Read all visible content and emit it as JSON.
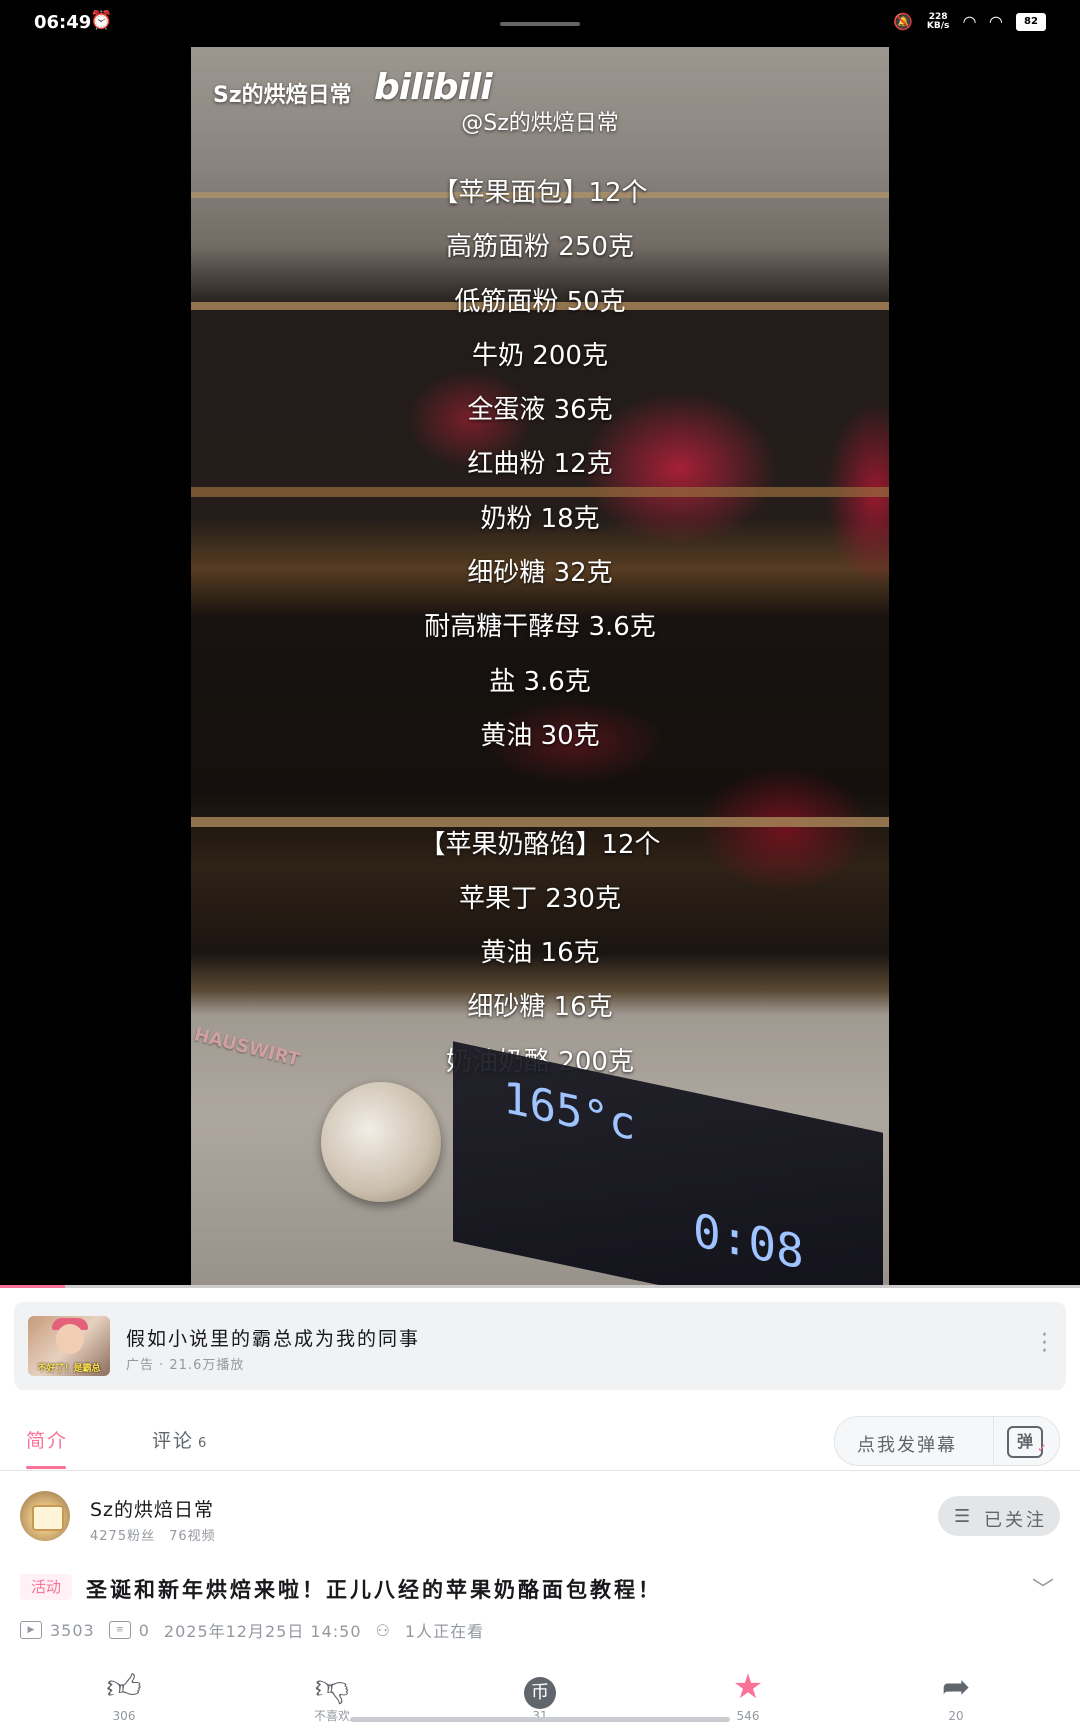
{
  "status_bar": {
    "time": "06:49",
    "alarm_icon": "alarm-icon",
    "net_speed": "228\nKB/s",
    "battery": "82"
  },
  "video": {
    "brand_text": "Sz的烘焙日常",
    "brand_logo": "bilibili",
    "watermark": "@Sz的烘焙日常",
    "recipe_lines": [
      "【苹果面包】12个",
      "高筋面粉 250克",
      "低筋面粉 50克",
      "牛奶 200克",
      "全蛋液 36克",
      "红曲粉 12克",
      "奶粉 18克",
      "细砂糖 32克",
      "耐高糖干酵母 3.6克",
      "盐 3.6克",
      "黄油 30克",
      "",
      "【苹果奶酪馅】12个",
      "苹果丁 230克",
      "黄油 16克",
      "细砂糖 16克",
      "奶油奶酪 200克"
    ],
    "oven_brand": "HAUSWIRT",
    "oven_temp": "165°c",
    "oven_timer": "0:08",
    "progress": 0.06
  },
  "ad": {
    "thumb_caption": "不好了！是霸总",
    "title": "假如小说里的霸总成为我的同事",
    "meta": "广告 · 21.6万播放"
  },
  "tabs": {
    "intro": "简介",
    "comments": "评论",
    "comments_count": "6",
    "danmaku_placeholder": "点我发弹幕",
    "danmaku_icon_text": "弹"
  },
  "uploader": {
    "name": "Sz的烘焙日常",
    "fans": "4275粉丝",
    "videos": "76视频",
    "follow_label": "已关注"
  },
  "video_info": {
    "badge": "活动",
    "title": "圣诞和新年烘焙来啦！正儿八经的苹果奶酪面包教程！",
    "plays": "3503",
    "danmaku_count": "0",
    "date": "2025年12月25日 14:50",
    "watching": "1人正在看"
  },
  "actions": [
    {
      "name": "like",
      "icon": "thumb-up-icon",
      "label": "306"
    },
    {
      "name": "dislike",
      "icon": "thumb-down-icon",
      "label": "不喜欢"
    },
    {
      "name": "coin",
      "icon": "coin-icon",
      "label": "31"
    },
    {
      "name": "favorite",
      "icon": "star-icon",
      "label": "546"
    },
    {
      "name": "share",
      "icon": "share-icon",
      "label": "20"
    }
  ],
  "colors": {
    "accent": "#fb7299",
    "text_primary": "#18191c",
    "text_secondary": "#9499a0"
  }
}
